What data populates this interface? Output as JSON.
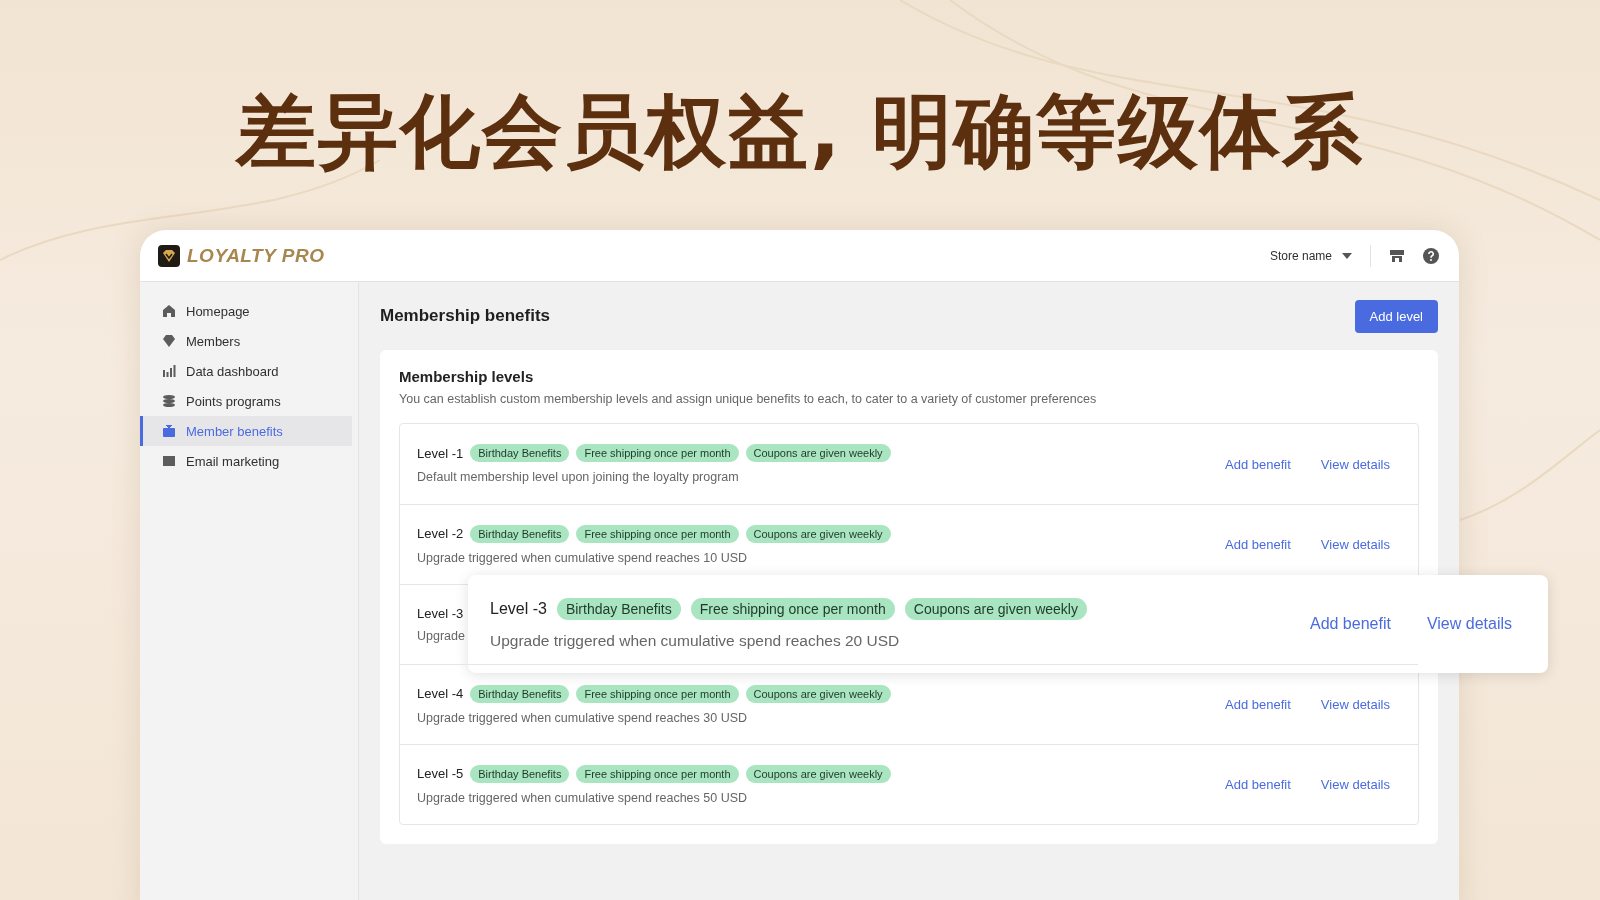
{
  "headline": "差异化会员权益, 明确等级体系",
  "app": {
    "logo_text": "LOYALTY PRO",
    "store_name": "Store name"
  },
  "sidebar": {
    "items": [
      {
        "label": "Homepage",
        "selected": false
      },
      {
        "label": "Members",
        "selected": false
      },
      {
        "label": "Data dashboard",
        "selected": false
      },
      {
        "label": "Points programs",
        "selected": false
      },
      {
        "label": "Member benefits",
        "selected": true
      },
      {
        "label": "Email marketing",
        "selected": false
      }
    ]
  },
  "page": {
    "title": "Membership benefits",
    "primary_button": "Add level"
  },
  "card": {
    "title": "Membership levels",
    "description": "You can establish custom membership levels and assign unique benefits to each, to cater to a variety of customer preferences"
  },
  "levels": [
    {
      "label": "Level -1",
      "tags": [
        "Birthday Benefits",
        "Free shipping once per month",
        "Coupons are given weekly"
      ],
      "description": "Default membership level upon joining the loyalty program",
      "actions": [
        "Add benefit",
        "View details"
      ]
    },
    {
      "label": "Level -2",
      "tags": [
        "Birthday Benefits",
        "Free shipping once per month",
        "Coupons are given weekly"
      ],
      "description": "Upgrade triggered when cumulative spend reaches 10 USD",
      "actions": [
        "Add benefit",
        "View details"
      ]
    },
    {
      "label": "Level -3",
      "description": "Upgrade",
      "highlight": {
        "label": "Level -3",
        "tags": [
          "Birthday Benefits",
          "Free shipping once per month",
          "Coupons are given weekly"
        ],
        "description": "Upgrade triggered when cumulative spend reaches 20 USD",
        "actions": [
          "Add benefit",
          "View details"
        ]
      }
    },
    {
      "label": "Level -4",
      "tags": [
        "Birthday Benefits",
        "Free shipping once per month",
        "Coupons are given weekly"
      ],
      "description": "Upgrade triggered when cumulative spend reaches 30 USD",
      "actions": [
        "Add benefit",
        "View details"
      ]
    },
    {
      "label": "Level -5",
      "tags": [
        "Birthday Benefits",
        "Free shipping once per month",
        "Coupons are given weekly"
      ],
      "description": "Upgrade triggered when cumulative spend reaches 50 USD",
      "actions": [
        "Add benefit",
        "View details"
      ]
    }
  ]
}
